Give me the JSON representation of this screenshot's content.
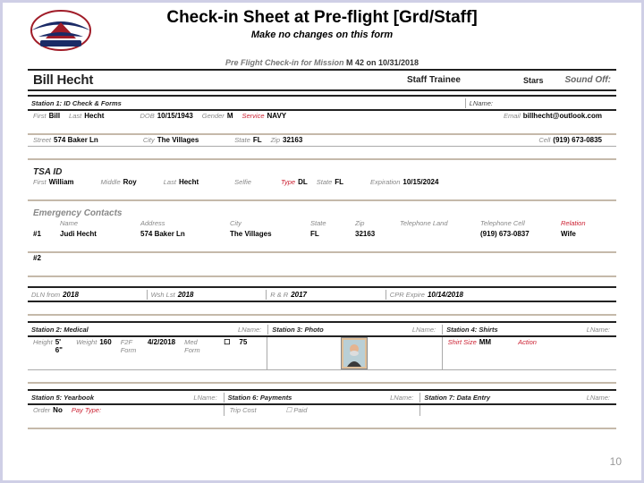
{
  "page": {
    "number": "10"
  },
  "header": {
    "title": "Check-in Sheet at  Pre-flight [Grd/Staff]",
    "subtitle": "Make no changes on this form"
  },
  "preflight": {
    "line_prefix": "Pre Flight Check-in for Mission",
    "line_suffix": "M 42 on 10/31/2018",
    "person_name": "Bill Hecht",
    "role": "Staff Trainee",
    "stars_label": "Stars",
    "soundoff_label": "Sound Off:"
  },
  "station1": {
    "title": "Station 1: ID Check & Forms",
    "lname_label": "LName:"
  },
  "id_row": {
    "first_label": "First",
    "first": "Bill",
    "last_label": "Last",
    "last": "Hecht",
    "dob_label": "DOB",
    "dob": "10/15/1943",
    "gender_label": "Gender",
    "gender": "M",
    "service_label": "Service",
    "service": "NAVY",
    "email_label": "Email",
    "email": "billhecht@outlook.com"
  },
  "addr_row": {
    "street_label": "Street",
    "street": "574 Baker Ln",
    "city_label": "City",
    "city": "The Villages",
    "state_label": "State",
    "state": "FL",
    "zip_label": "Zip",
    "zip": "32163",
    "cell_label": "Cell",
    "cell": "(919) 673-0835"
  },
  "tsa": {
    "title": "TSA ID",
    "first_label": "First",
    "first": "William",
    "middle_label": "Middle",
    "middle": "Roy",
    "last_label": "Last",
    "last": "Hecht",
    "selfie_label": "Selfie",
    "type_label": "Type",
    "type": "DL",
    "state_label": "State",
    "state": "FL",
    "exp_label": "Expiration",
    "exp": "10/15/2024"
  },
  "emerg": {
    "title": "Emergency Contacts",
    "cols": {
      "name": "Name",
      "address": "Address",
      "city": "City",
      "state": "State",
      "zip": "Zip",
      "tele_land": "Telephone Land",
      "tele_cell": "Telephone Cell",
      "relation": "Relation"
    },
    "row1": {
      "idx": "#1",
      "name": "Judi Hecht",
      "address": "574 Baker Ln",
      "city": "The Villages",
      "state": "FL",
      "zip": "32163",
      "tele_land": "",
      "tele_cell": "(919) 673-0837",
      "relation": "Wife"
    },
    "row2": {
      "idx": "#2"
    }
  },
  "docs": {
    "dln_from_label": "DLN from",
    "dln_from": "2018",
    "wsh_lst_label": "Wsh Lst",
    "wsh_lst": "2018",
    "rr_label": "R & R",
    "rr": "2017",
    "cpr_label": "CPR Expire",
    "cpr": "10/14/2018"
  },
  "station2": {
    "title": "Station 2: Medical",
    "lname_label": "LName:"
  },
  "station3": {
    "title": "Station 3: Photo",
    "lname_label": "LName:"
  },
  "station4": {
    "title": "Station 4: Shirts",
    "lname_label": "LName:"
  },
  "med": {
    "height_label": "Height",
    "height": "5' 6\"",
    "weight_label": "Weight",
    "weight": "160",
    "f2f_label": "F2F Form",
    "f2f": "4/2/2018",
    "medform_label": "Med Form",
    "checkbox": "☐",
    "v75": "75"
  },
  "shirt": {
    "size_label": "Shirt Size",
    "size": "MM",
    "action_label": "Action"
  },
  "station5": {
    "title": "Station 5: Yearbook",
    "lname_label": "LName:"
  },
  "station6": {
    "title": "Station 6: Payments",
    "lname_label": "LName:"
  },
  "station7": {
    "title": "Station 7: Data Entry",
    "lname_label": "LName:"
  },
  "pay": {
    "order_label": "Order",
    "order": "No",
    "paytype_label": "Pay Type:",
    "trip_label": "Trip Cost",
    "paid_label": "☐ Paid"
  }
}
